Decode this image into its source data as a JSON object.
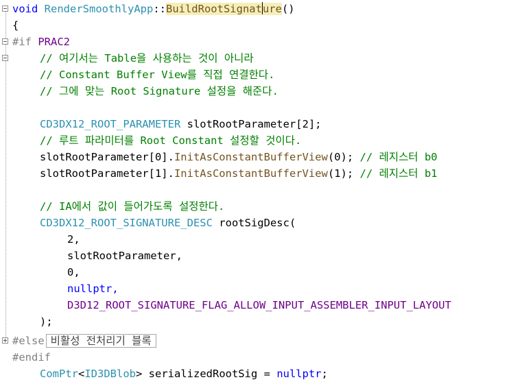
{
  "editor": {
    "lines": {
      "l1_kw": "void",
      "l1_cls": "RenderSmoothlyApp",
      "l1_sep": "::",
      "l1_fn_a": "BuildRootSignat",
      "l1_fn_b": "ure",
      "l1_paren": "()",
      "l2": "{",
      "l3_pp": "#if",
      "l3_mac": "PRAC2",
      "l4": "// 여기서는 Table을 사용하는 것이 아니라",
      "l5": "// Constant Buffer View를 직접 연결한다.",
      "l6": "// 그에 맞는 Root Signature 설정을 해준다.",
      "l8_type": "CD3DX12_ROOT_PARAMETER",
      "l8_rest": " slotRootParameter[2];",
      "l9": "// 루트 파라미터를 Root Constant 설정할 것이다.",
      "l10_a": "slotRootParameter[0].",
      "l10_fn": "InitAsConstantBufferView",
      "l10_b": "(0); ",
      "l10_cmt": "// 레지스터 b0",
      "l11_a": "slotRootParameter[1].",
      "l11_fn": "InitAsConstantBufferView",
      "l11_b": "(1); ",
      "l11_cmt": "// 레지스터 b1",
      "l13": "// IA에서 값이 들어가도록 설정한다.",
      "l14_type": "CD3DX12_ROOT_SIGNATURE_DESC",
      "l14_rest": " rootSigDesc(",
      "l15": "2,",
      "l16": "slotRootParameter,",
      "l17": "0,",
      "l18": "nullptr,",
      "l19_mac": "D3D12_ROOT_SIGNATURE_FLAG_ALLOW_INPUT_ASSEMBLER_INPUT_LAYOUT",
      "l20": ");",
      "l21_pp": "#else",
      "l21_collapsed": "비활성 전처리기 블록",
      "l22_pp": "#endif",
      "l23_cls": "ComPtr",
      "l23_lt": "<",
      "l23_type": "ID3DBlob",
      "l23_mid": "> serializedRootSig = ",
      "l23_kw": "nullptr",
      "l23_end": ";"
    },
    "fold_icons": [
      "minus-icon",
      "minus-icon",
      "plus-icon"
    ]
  }
}
